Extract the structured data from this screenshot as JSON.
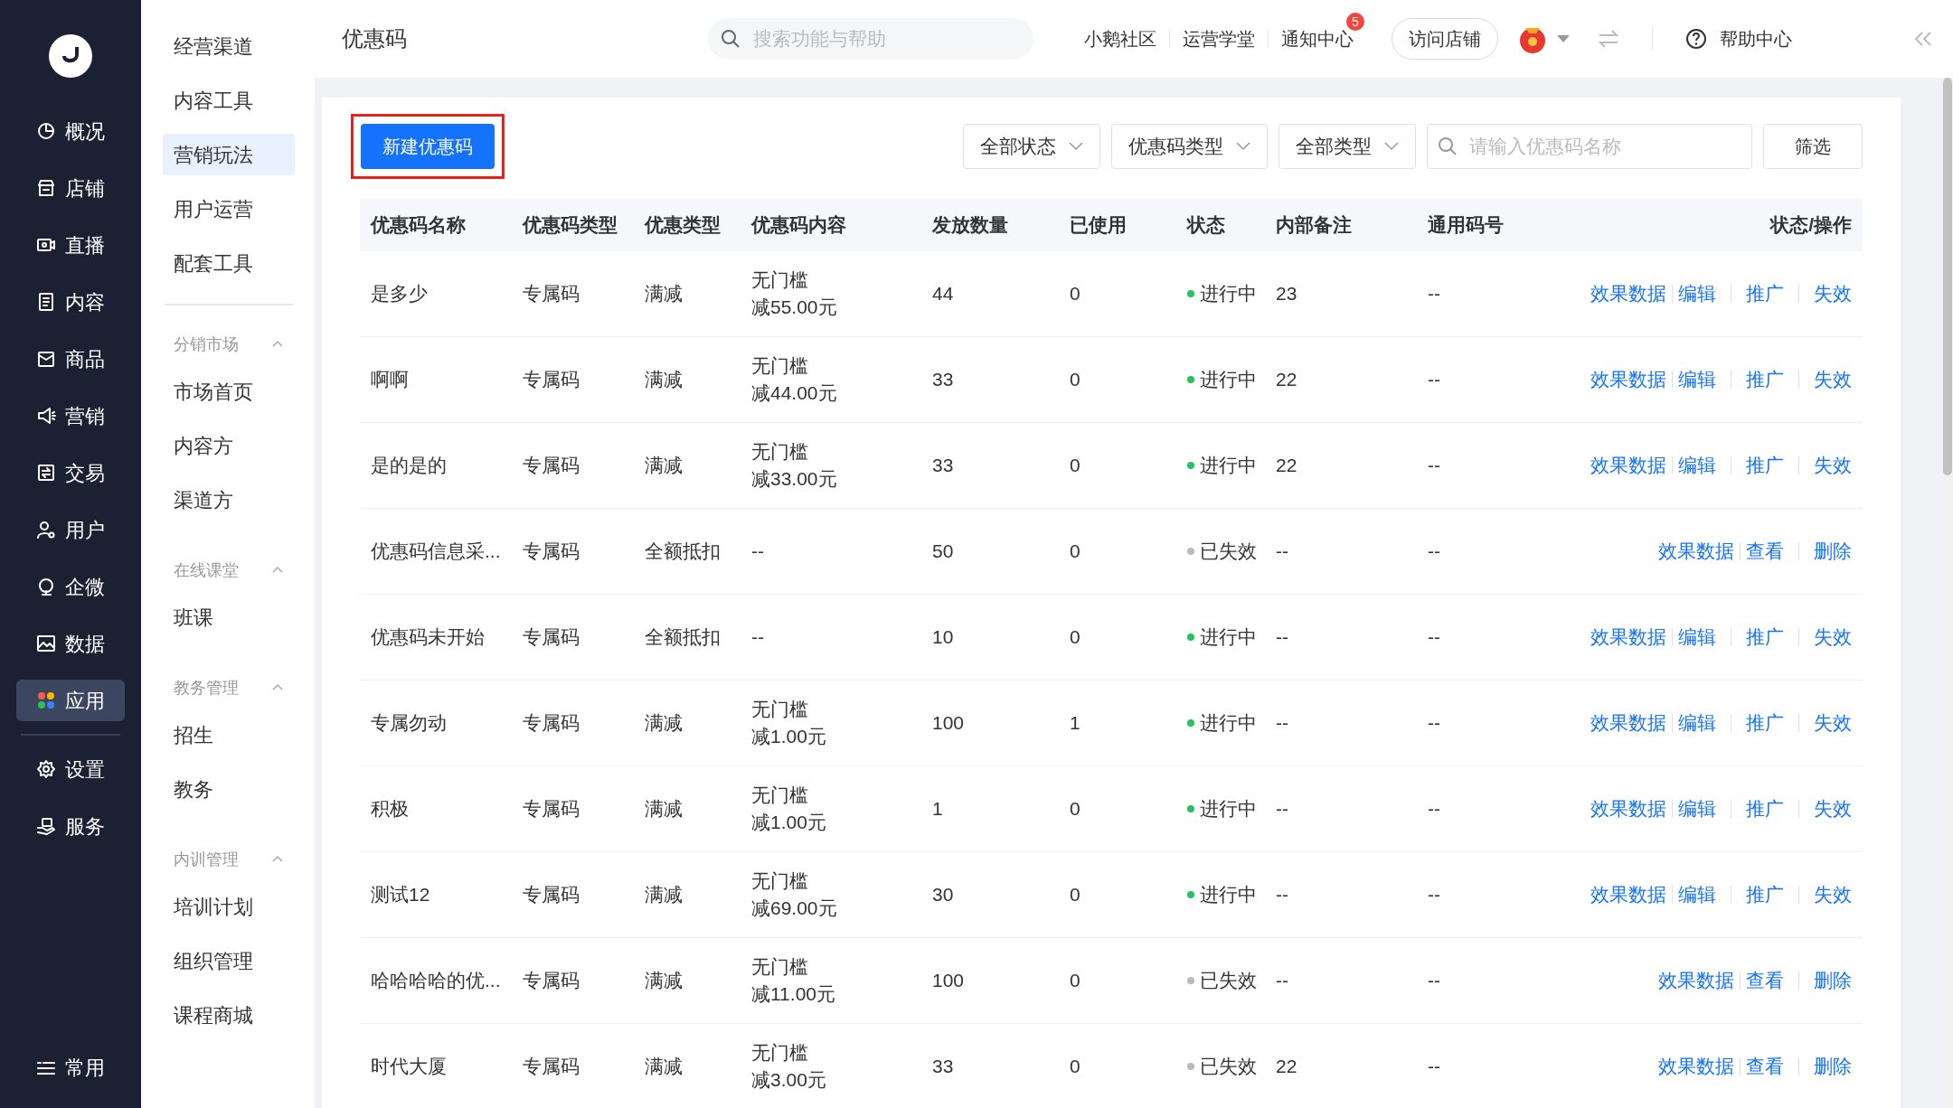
{
  "main_nav": {
    "items": [
      {
        "label": "概况",
        "selected": false
      },
      {
        "label": "店铺",
        "selected": false
      },
      {
        "label": "直播",
        "selected": false
      },
      {
        "label": "内容",
        "selected": false
      },
      {
        "label": "商品",
        "selected": false
      },
      {
        "label": "营销",
        "selected": false
      },
      {
        "label": "交易",
        "selected": false
      },
      {
        "label": "用户",
        "selected": false
      },
      {
        "label": "企微",
        "selected": false
      },
      {
        "label": "数据",
        "selected": false
      },
      {
        "label": "应用",
        "selected": true
      }
    ],
    "lower_items": [
      {
        "label": "设置",
        "selected": false
      },
      {
        "label": "服务",
        "selected": false
      }
    ],
    "bottom_item": {
      "label": "常用"
    }
  },
  "sub_nav": {
    "items": [
      {
        "label": "经营渠道",
        "selected": false
      },
      {
        "label": "内容工具",
        "selected": false
      },
      {
        "label": "营销玩法",
        "selected": true
      },
      {
        "label": "用户运营",
        "selected": false
      },
      {
        "label": "配套工具",
        "selected": false
      }
    ],
    "groups": [
      {
        "title": "分销市场",
        "expanded": true,
        "items": [
          "市场首页",
          "内容方",
          "渠道方"
        ]
      },
      {
        "title": "在线课堂",
        "expanded": true,
        "items": [
          "班课"
        ]
      },
      {
        "title": "教务管理",
        "expanded": true,
        "items": [
          "招生",
          "教务"
        ]
      },
      {
        "title": "内训管理",
        "expanded": true,
        "items": [
          "培训计划",
          "组织管理",
          "课程商城"
        ]
      }
    ]
  },
  "header": {
    "title": "优惠码",
    "search_placeholder": "搜索功能与帮助",
    "links": [
      "小鹅社区",
      "运营学堂",
      "通知中心"
    ],
    "notification_badge": "5",
    "visit_button": "访问店铺",
    "help": "帮助中心"
  },
  "toolbar": {
    "create_button": "新建优惠码",
    "create_highlighted": true,
    "filters": [
      "全部状态",
      "优惠码类型",
      "全部类型"
    ],
    "search_placeholder": "请输入优惠码名称",
    "filter_button": "筛选"
  },
  "table": {
    "columns": [
      "优惠码名称",
      "优惠码类型",
      "优惠类型",
      "优惠码内容",
      "发放数量",
      "已使用",
      "状态",
      "内部备注",
      "通用码号",
      "状态/操作"
    ],
    "rows": [
      {
        "name": "是多少",
        "code_type": "专属码",
        "discount_type": "满减",
        "content": [
          "无门槛",
          "减55.00元"
        ],
        "issued": "44",
        "used": "0",
        "status": {
          "label": "进行中",
          "color": "#22c55e"
        },
        "note": "23",
        "common_code": "--",
        "actions": [
          "效果数据",
          "编辑",
          "推广",
          "失效"
        ]
      },
      {
        "name": "啊啊",
        "code_type": "专属码",
        "discount_type": "满减",
        "content": [
          "无门槛",
          "减44.00元"
        ],
        "issued": "33",
        "used": "0",
        "status": {
          "label": "进行中",
          "color": "#22c55e"
        },
        "note": "22",
        "common_code": "--",
        "actions": [
          "效果数据",
          "编辑",
          "推广",
          "失效"
        ]
      },
      {
        "name": "是的是的",
        "code_type": "专属码",
        "discount_type": "满减",
        "content": [
          "无门槛",
          "减33.00元"
        ],
        "issued": "33",
        "used": "0",
        "status": {
          "label": "进行中",
          "color": "#22c55e"
        },
        "note": "22",
        "common_code": "--",
        "actions": [
          "效果数据",
          "编辑",
          "推广",
          "失效"
        ]
      },
      {
        "name": "优惠码信息采...",
        "code_type": "专属码",
        "discount_type": "全额抵扣",
        "content": [
          "--"
        ],
        "issued": "50",
        "used": "0",
        "status": {
          "label": "已失效",
          "color": "#bbbbbb"
        },
        "note": "--",
        "common_code": "--",
        "actions": [
          "效果数据",
          "查看",
          "删除"
        ]
      },
      {
        "name": "优惠码未开始",
        "code_type": "专属码",
        "discount_type": "全额抵扣",
        "content": [
          "--"
        ],
        "issued": "10",
        "used": "0",
        "status": {
          "label": "进行中",
          "color": "#22c55e"
        },
        "note": "--",
        "common_code": "--",
        "actions": [
          "效果数据",
          "编辑",
          "推广",
          "失效"
        ]
      },
      {
        "name": "专属勿动",
        "code_type": "专属码",
        "discount_type": "满减",
        "content": [
          "无门槛",
          "减1.00元"
        ],
        "issued": "100",
        "used": "1",
        "status": {
          "label": "进行中",
          "color": "#22c55e"
        },
        "note": "--",
        "common_code": "--",
        "actions": [
          "效果数据",
          "编辑",
          "推广",
          "失效"
        ]
      },
      {
        "name": "积极",
        "code_type": "专属码",
        "discount_type": "满减",
        "content": [
          "无门槛",
          "减1.00元"
        ],
        "issued": "1",
        "used": "0",
        "status": {
          "label": "进行中",
          "color": "#22c55e"
        },
        "note": "--",
        "common_code": "--",
        "actions": [
          "效果数据",
          "编辑",
          "推广",
          "失效"
        ]
      },
      {
        "name": "测试12",
        "code_type": "专属码",
        "discount_type": "满减",
        "content": [
          "无门槛",
          "减69.00元"
        ],
        "issued": "30",
        "used": "0",
        "status": {
          "label": "进行中",
          "color": "#22c55e"
        },
        "note": "--",
        "common_code": "--",
        "actions": [
          "效果数据",
          "编辑",
          "推广",
          "失效"
        ]
      },
      {
        "name": "哈哈哈哈的优...",
        "code_type": "专属码",
        "discount_type": "满减",
        "content": [
          "无门槛",
          "减11.00元"
        ],
        "issued": "100",
        "used": "0",
        "status": {
          "label": "已失效",
          "color": "#bbbbbb"
        },
        "note": "--",
        "common_code": "--",
        "actions": [
          "效果数据",
          "查看",
          "删除"
        ]
      },
      {
        "name": "时代大厦",
        "code_type": "专属码",
        "discount_type": "满减",
        "content": [
          "无门槛",
          "减3.00元"
        ],
        "issued": "33",
        "used": "0",
        "status": {
          "label": "已失效",
          "color": "#bbbbbb"
        },
        "note": "22",
        "common_code": "--",
        "actions": [
          "效果数据",
          "查看",
          "删除"
        ]
      }
    ]
  }
}
